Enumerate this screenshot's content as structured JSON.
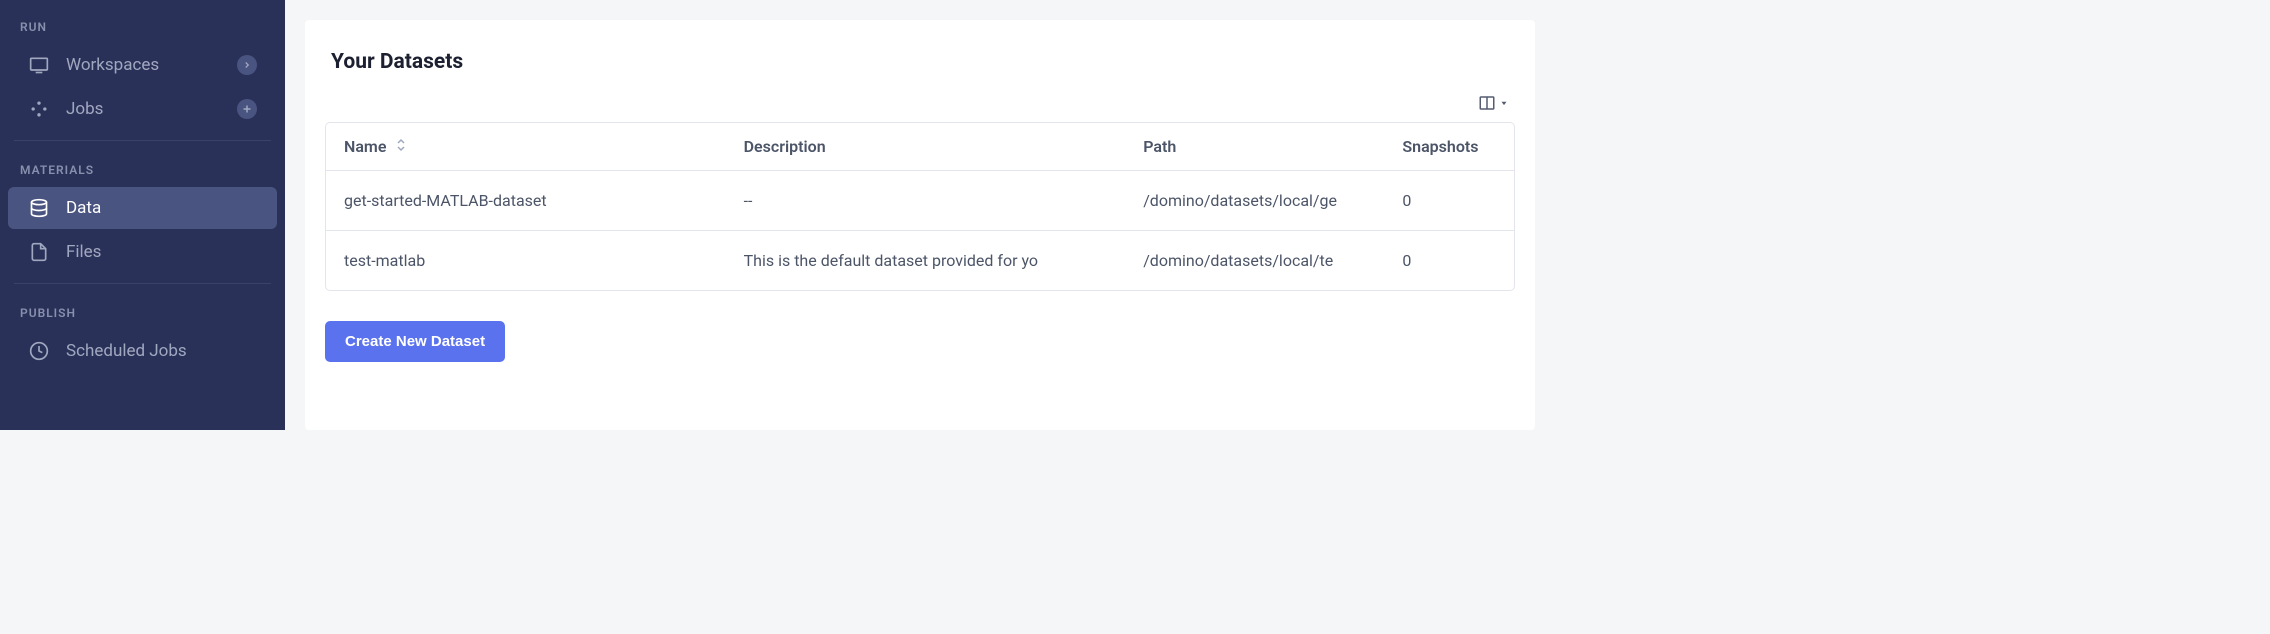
{
  "sidebar": {
    "sections": {
      "run": {
        "label": "RUN"
      },
      "materials": {
        "label": "MATERIALS"
      },
      "publish": {
        "label": "PUBLISH"
      }
    },
    "workspaces": {
      "label": "Workspaces"
    },
    "jobs": {
      "label": "Jobs"
    },
    "data": {
      "label": "Data"
    },
    "files": {
      "label": "Files"
    },
    "scheduled_jobs": {
      "label": "Scheduled Jobs"
    }
  },
  "main": {
    "title": "Your Datasets",
    "columns": {
      "name": "Name",
      "description": "Description",
      "path": "Path",
      "snapshots": "Snapshots"
    },
    "rows": [
      {
        "name": "get-started-MATLAB-dataset",
        "description": "--",
        "path": "/domino/datasets/local/ge",
        "snapshots": "0"
      },
      {
        "name": "test-matlab",
        "description": "This is the default dataset provided for yo",
        "path": "/domino/datasets/local/te",
        "snapshots": "0"
      }
    ],
    "create_button": "Create New Dataset"
  }
}
